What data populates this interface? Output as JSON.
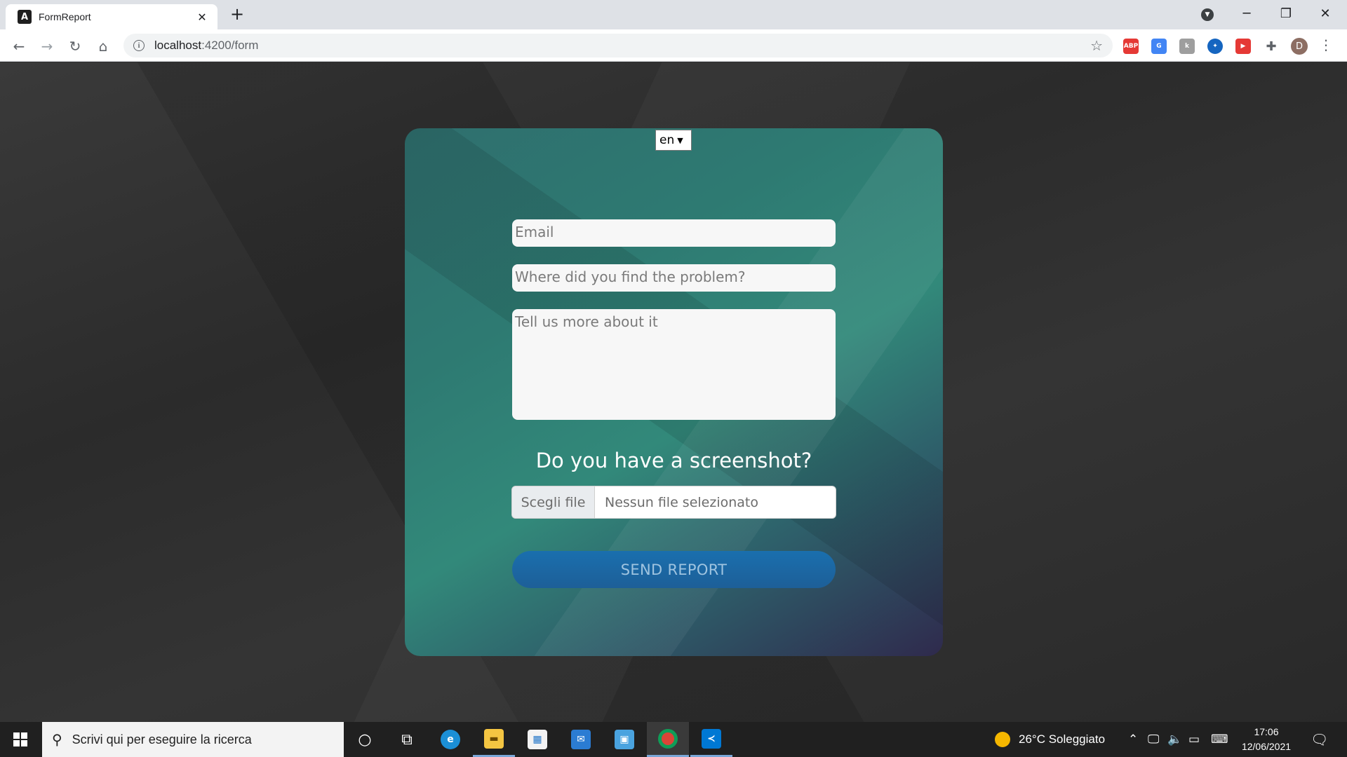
{
  "browser": {
    "tab_title": "FormReport",
    "tab_favicon_letter": "A",
    "url_host": "localhost",
    "url_path": ":4200/form"
  },
  "form": {
    "language": "en",
    "email_placeholder": "Email",
    "where_placeholder": "Where did you find the problem?",
    "more_placeholder": "Tell us more about it",
    "screenshot_question": "Do you have a screenshot?",
    "file_button": "Scegli file",
    "file_status": "Nessun file selezionato",
    "send_label": "SEND REPORT"
  },
  "colors": {
    "send_button": "#1a6fae",
    "card_top": "#2f6f6e",
    "card_bottom": "#2f2a4d",
    "page_bg": "#2f2f2f"
  },
  "extensions": [
    {
      "name": "adblock-plus-icon",
      "label": "ABP",
      "color": "#e53935"
    },
    {
      "name": "google-translate-icon",
      "label": "G",
      "color": "#4285f4"
    },
    {
      "name": "extension-gray-icon",
      "label": "k",
      "color": "#9e9e9e"
    },
    {
      "name": "extension-blue-icon",
      "label": "✦",
      "color": "#1565c0"
    },
    {
      "name": "youtube-extension-icon",
      "label": "▶",
      "color": "#e53935"
    }
  ],
  "profile_initial": "D",
  "taskbar": {
    "search_placeholder": "Scrivi qui per eseguire la ricerca",
    "weather": "26°C  Soleggiato",
    "time": "17:06",
    "date": "12/06/2021"
  }
}
